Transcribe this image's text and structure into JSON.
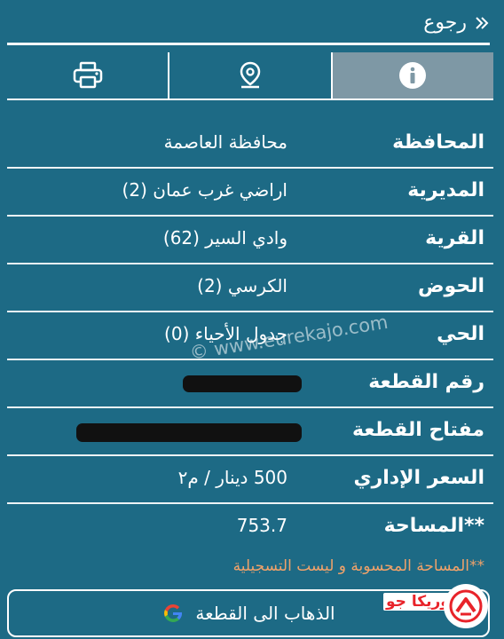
{
  "header": {
    "back_label": "رجوع"
  },
  "tabs": [
    {
      "name": "info",
      "icon": "info-icon",
      "active": true
    },
    {
      "name": "location",
      "icon": "map-pin-icon",
      "active": false
    },
    {
      "name": "print",
      "icon": "printer-icon",
      "active": false
    }
  ],
  "details": {
    "governorate": {
      "label": "المحافظة",
      "value": "محافظة العاصمة"
    },
    "directorate": {
      "label": "المديرية",
      "value": "اراضي غرب عمان (2)"
    },
    "village": {
      "label": "القرية",
      "value": "وادي السير (62)"
    },
    "basin": {
      "label": "الحوض",
      "value": "الكرسي (2)"
    },
    "district": {
      "label": "الحي",
      "value": "جدول الأحياء (0)"
    },
    "plot_number": {
      "label": "رقم القطعة"
    },
    "plot_key": {
      "label": "مفتاح القطعة"
    },
    "admin_price": {
      "label": "السعر الإداري",
      "value": "500 دينار / م٢"
    },
    "area": {
      "label": "**المساحة",
      "value": "753.7"
    }
  },
  "watermark": "© www.eurekajo.com",
  "note": "**المساحة المحسوبة و ليست التسجيلية",
  "maps_button": {
    "label": "الذهاب الى القطعة",
    "icon": "google-g-icon"
  },
  "logo": {
    "text": "يوريكا جو",
    "icon": "eureka-logo-icon"
  },
  "colors": {
    "background": "#1d6a85",
    "active_tab": "#7e98a5",
    "note": "#f0a26a",
    "logo_red": "#e8232a"
  }
}
